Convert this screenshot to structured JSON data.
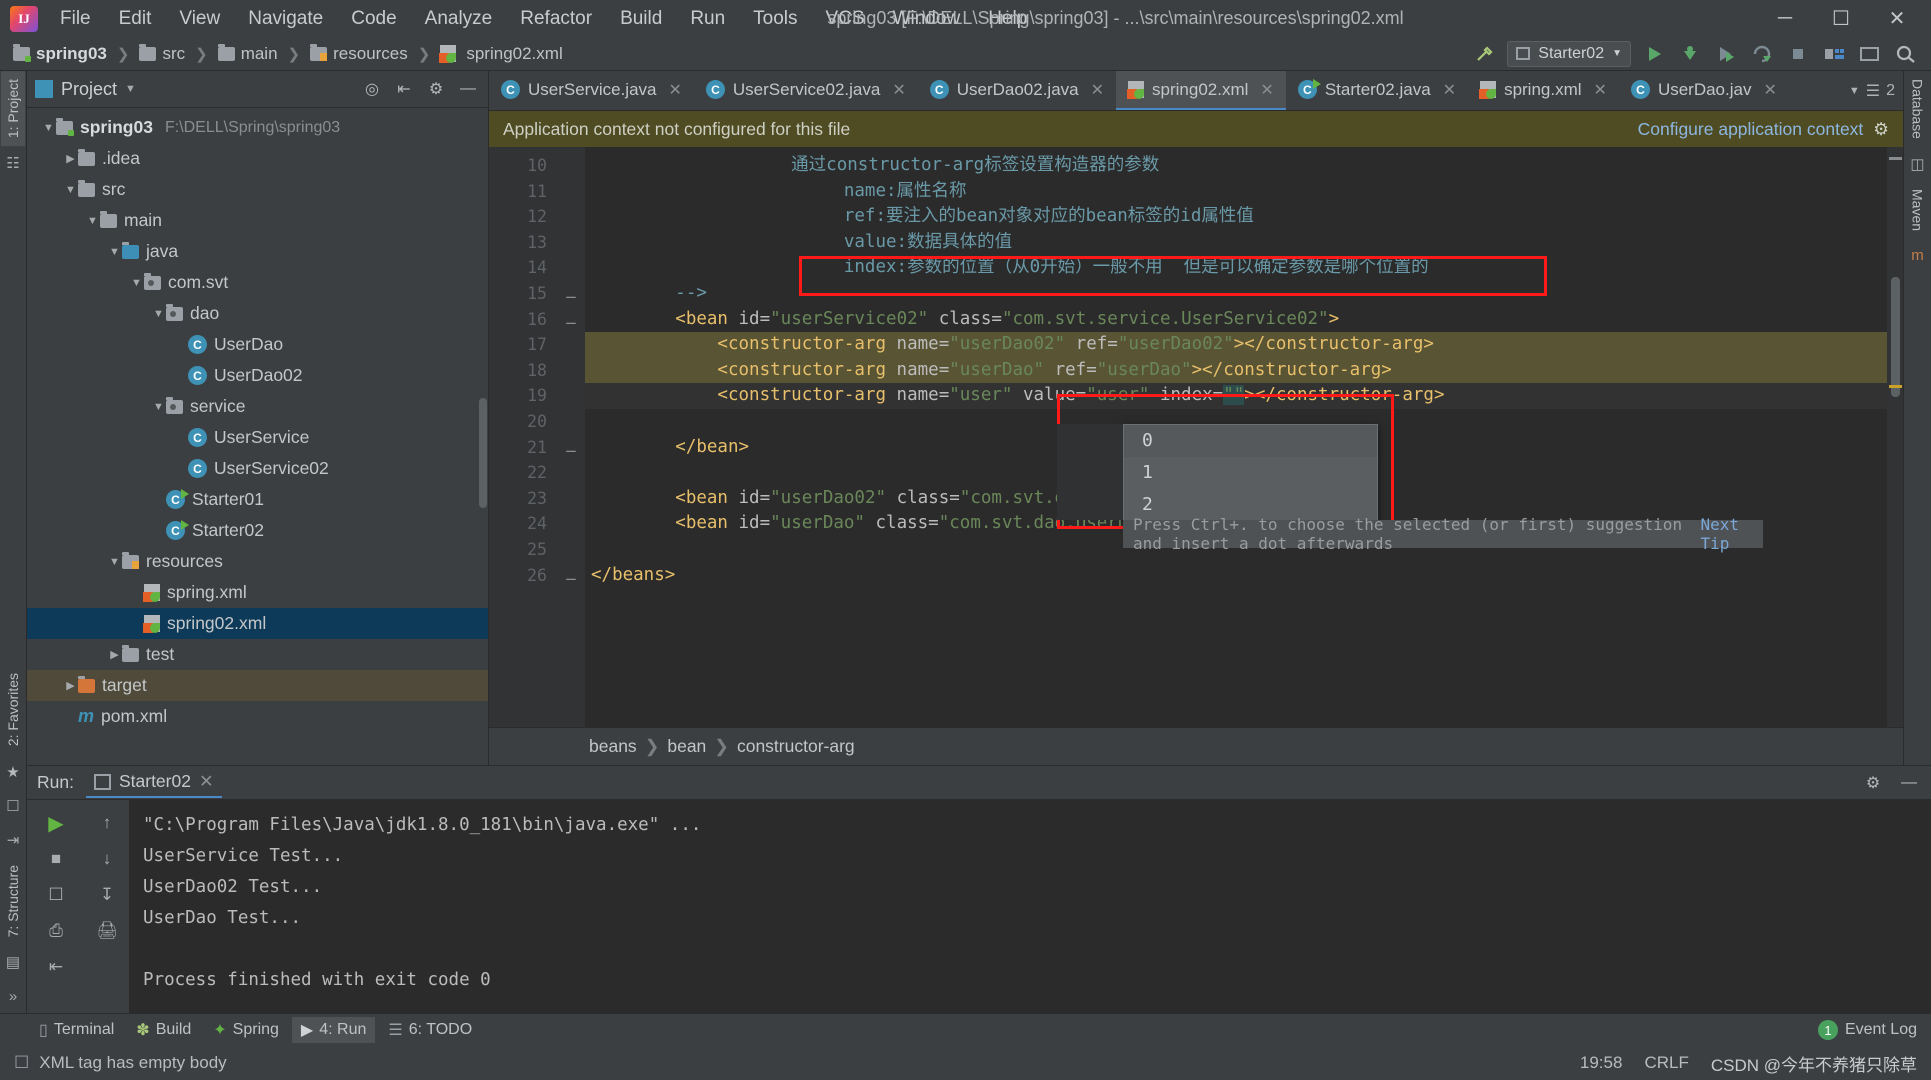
{
  "window": {
    "title": "spring03 [F:\\DELL\\Spring\\spring03] - ...\\src\\main\\resources\\spring02.xml",
    "minimize": "─",
    "maximize": "☐",
    "close": "✕",
    "logo": "IJ"
  },
  "menu": [
    "File",
    "Edit",
    "View",
    "Navigate",
    "Code",
    "Analyze",
    "Refactor",
    "Build",
    "Run",
    "Tools",
    "VCS",
    "Window",
    "Help"
  ],
  "breadcrumb": [
    {
      "label": "spring03",
      "icon": "folder-icon",
      "bold": true
    },
    {
      "label": "src",
      "icon": "folder-icon",
      "bold": false
    },
    {
      "label": "main",
      "icon": "folder-icon",
      "bold": false
    },
    {
      "label": "resources",
      "icon": "resources-folder-icon",
      "bold": false
    },
    {
      "label": "spring02.xml",
      "icon": "xml-file-icon",
      "bold": false
    }
  ],
  "toolbar": {
    "run_config": "Starter02",
    "hammer_icon": "build-hammer-icon",
    "run_icon": "run-icon",
    "debug_icon": "debug-icon",
    "run_coverage_icon": "run-with-coverage-icon",
    "profile_icon": "profile-icon",
    "stop_icon": "stop-icon",
    "layout_icon": "layout-icon",
    "terminal_icon": "open-terminal-icon",
    "search_icon": "search-everywhere-icon"
  },
  "project_panel": {
    "title": "Project",
    "icons": [
      "collapse-scope-icon",
      "collapse-all-icon",
      "settings-gear-icon",
      "hide-icon"
    ],
    "tree": [
      {
        "depth": 0,
        "arrow": "▼",
        "label": "spring03",
        "path": "F:\\DELL\\Spring\\spring03",
        "icon": "module-folder-icon",
        "bold": true,
        "state": "normal"
      },
      {
        "depth": 1,
        "arrow": "▶",
        "label": ".idea",
        "path": "",
        "icon": "folder-icon",
        "bold": false,
        "state": "normal"
      },
      {
        "depth": 1,
        "arrow": "▼",
        "label": "src",
        "path": "",
        "icon": "folder-icon",
        "bold": false,
        "state": "normal"
      },
      {
        "depth": 2,
        "arrow": "▼",
        "label": "main",
        "path": "",
        "icon": "folder-icon",
        "bold": false,
        "state": "normal"
      },
      {
        "depth": 3,
        "arrow": "▼",
        "label": "java",
        "path": "",
        "icon": "source-folder-icon",
        "bold": false,
        "state": "normal"
      },
      {
        "depth": 4,
        "arrow": "▼",
        "label": "com.svt",
        "path": "",
        "icon": "package-icon",
        "bold": false,
        "state": "normal"
      },
      {
        "depth": 5,
        "arrow": "▼",
        "label": "dao",
        "path": "",
        "icon": "package-icon",
        "bold": false,
        "state": "normal"
      },
      {
        "depth": 6,
        "arrow": "",
        "label": "UserDao",
        "path": "",
        "icon": "java-class-icon",
        "bold": false,
        "state": "normal"
      },
      {
        "depth": 6,
        "arrow": "",
        "label": "UserDao02",
        "path": "",
        "icon": "java-class-icon",
        "bold": false,
        "state": "normal"
      },
      {
        "depth": 5,
        "arrow": "▼",
        "label": "service",
        "path": "",
        "icon": "package-icon",
        "bold": false,
        "state": "normal"
      },
      {
        "depth": 6,
        "arrow": "",
        "label": "UserService",
        "path": "",
        "icon": "java-class-icon",
        "bold": false,
        "state": "normal"
      },
      {
        "depth": 6,
        "arrow": "",
        "label": "UserService02",
        "path": "",
        "icon": "java-class-icon",
        "bold": false,
        "state": "normal"
      },
      {
        "depth": 5,
        "arrow": "",
        "label": "Starter01",
        "path": "",
        "icon": "java-runnable-class-icon",
        "bold": false,
        "state": "normal"
      },
      {
        "depth": 5,
        "arrow": "",
        "label": "Starter02",
        "path": "",
        "icon": "java-runnable-class-icon",
        "bold": false,
        "state": "normal"
      },
      {
        "depth": 3,
        "arrow": "▼",
        "label": "resources",
        "path": "",
        "icon": "resources-folder-icon",
        "bold": false,
        "state": "normal"
      },
      {
        "depth": 4,
        "arrow": "",
        "label": "spring.xml",
        "path": "",
        "icon": "xml-file-icon",
        "bold": false,
        "state": "normal"
      },
      {
        "depth": 4,
        "arrow": "",
        "label": "spring02.xml",
        "path": "",
        "icon": "xml-file-icon",
        "bold": false,
        "state": "selected"
      },
      {
        "depth": 3,
        "arrow": "▶",
        "label": "test",
        "path": "",
        "icon": "folder-icon",
        "bold": false,
        "state": "normal"
      },
      {
        "depth": 1,
        "arrow": "▶",
        "label": "target",
        "path": "",
        "icon": "excluded-folder-icon",
        "bold": false,
        "state": "target"
      },
      {
        "depth": 1,
        "arrow": "",
        "label": "pom.xml",
        "path": "",
        "icon": "maven-icon",
        "bold": false,
        "state": "normal"
      }
    ]
  },
  "left_strips": {
    "project_tab": "1: Project",
    "favorites_tab": "2: Favorites",
    "structure_tab": "7: Structure"
  },
  "right_strips": {
    "database_tab": "Database",
    "maven_tab": "Maven"
  },
  "editor_tabs": [
    {
      "label": "UserService.java",
      "icon": "java-class-icon",
      "active": false
    },
    {
      "label": "UserService02.java",
      "icon": "java-class-icon",
      "active": false
    },
    {
      "label": "UserDao02.java",
      "icon": "java-class-icon",
      "active": false
    },
    {
      "label": "spring02.xml",
      "icon": "xml-file-icon",
      "active": true
    },
    {
      "label": "Starter02.java",
      "icon": "java-runnable-class-icon",
      "active": false
    },
    {
      "label": "spring.xml",
      "icon": "xml-file-icon",
      "active": false
    },
    {
      "label": "UserDao.jav",
      "icon": "java-class-icon",
      "active": false
    }
  ],
  "editor_tabs_overflow": "2",
  "notification": {
    "message": "Application context not configured for this file",
    "action": "Configure application context",
    "gear_icon": "settings-gear-icon"
  },
  "code": {
    "line_numbers": [
      "10",
      "11",
      "12",
      "13",
      "14",
      "15",
      "16",
      "17",
      "18",
      "19",
      "20",
      "21",
      "22",
      "23",
      "24",
      "25",
      "26"
    ],
    "lines": [
      "                   通过constructor-arg标签设置构造器的参数",
      "                        name:属性名称",
      "                        ref:要注入的bean对象对应的bean标签的id属性值",
      "                        value:数据具体的值",
      "                        index:参数的位置（从0开始）一般不用  但是可以确定参数是哪个位置的",
      "        -->",
      "        <bean id=\"userService02\" class=\"com.svt.service.UserService02\">",
      "            <constructor-arg name=\"userDao02\" ref=\"userDao02\"></constructor-arg>",
      "            <constructor-arg name=\"userDao\" ref=\"userDao\"></constructor-arg>",
      "            <constructor-arg name=\"user\" value=\"user\" index=\"\"></constructor-arg>",
      "",
      "        </bean>",
      "",
      "        <bean id=\"userDao02\" class=\"com.svt.dao.UserDao02\"></bean>",
      "        <bean id=\"userDao\" class=\"com.svt.dao.UserDao\"></bean>",
      "",
      "</beans>"
    ]
  },
  "autocomplete": {
    "options": [
      "0",
      "1",
      "2"
    ],
    "selected": "0",
    "hint": "Press Ctrl+. to choose the selected (or first) suggestion and insert a dot afterwards",
    "next_tip": "Next Tip"
  },
  "xml_breadcrumb": [
    "beans",
    "bean",
    "constructor-arg"
  ],
  "run_panel": {
    "label": "Run:",
    "tab": "Starter02",
    "console": [
      "\"C:\\Program Files\\Java\\jdk1.8.0_181\\bin\\java.exe\" ...",
      "UserService Test...",
      "UserDao02 Test...",
      "UserDao Test...",
      "",
      "Process finished with exit code 0"
    ]
  },
  "bottom_tabs": [
    {
      "label": "Terminal",
      "icon": "terminal-icon",
      "active": false
    },
    {
      "label": "Build",
      "icon": "build-hammer-icon",
      "active": false
    },
    {
      "label": "Spring",
      "icon": "spring-leaf-icon",
      "active": false
    },
    {
      "label": "4: Run",
      "icon": "run-icon",
      "active": true
    },
    {
      "label": "6: TODO",
      "icon": "todo-icon",
      "active": false
    }
  ],
  "event_log": {
    "label": "Event Log",
    "count": "1"
  },
  "status": {
    "message": "XML tag has empty body",
    "icon": "inspection-icon",
    "time": "19:58",
    "line_separator": "CRLF",
    "watermark": "CSDN @今年不养猪只除草"
  }
}
